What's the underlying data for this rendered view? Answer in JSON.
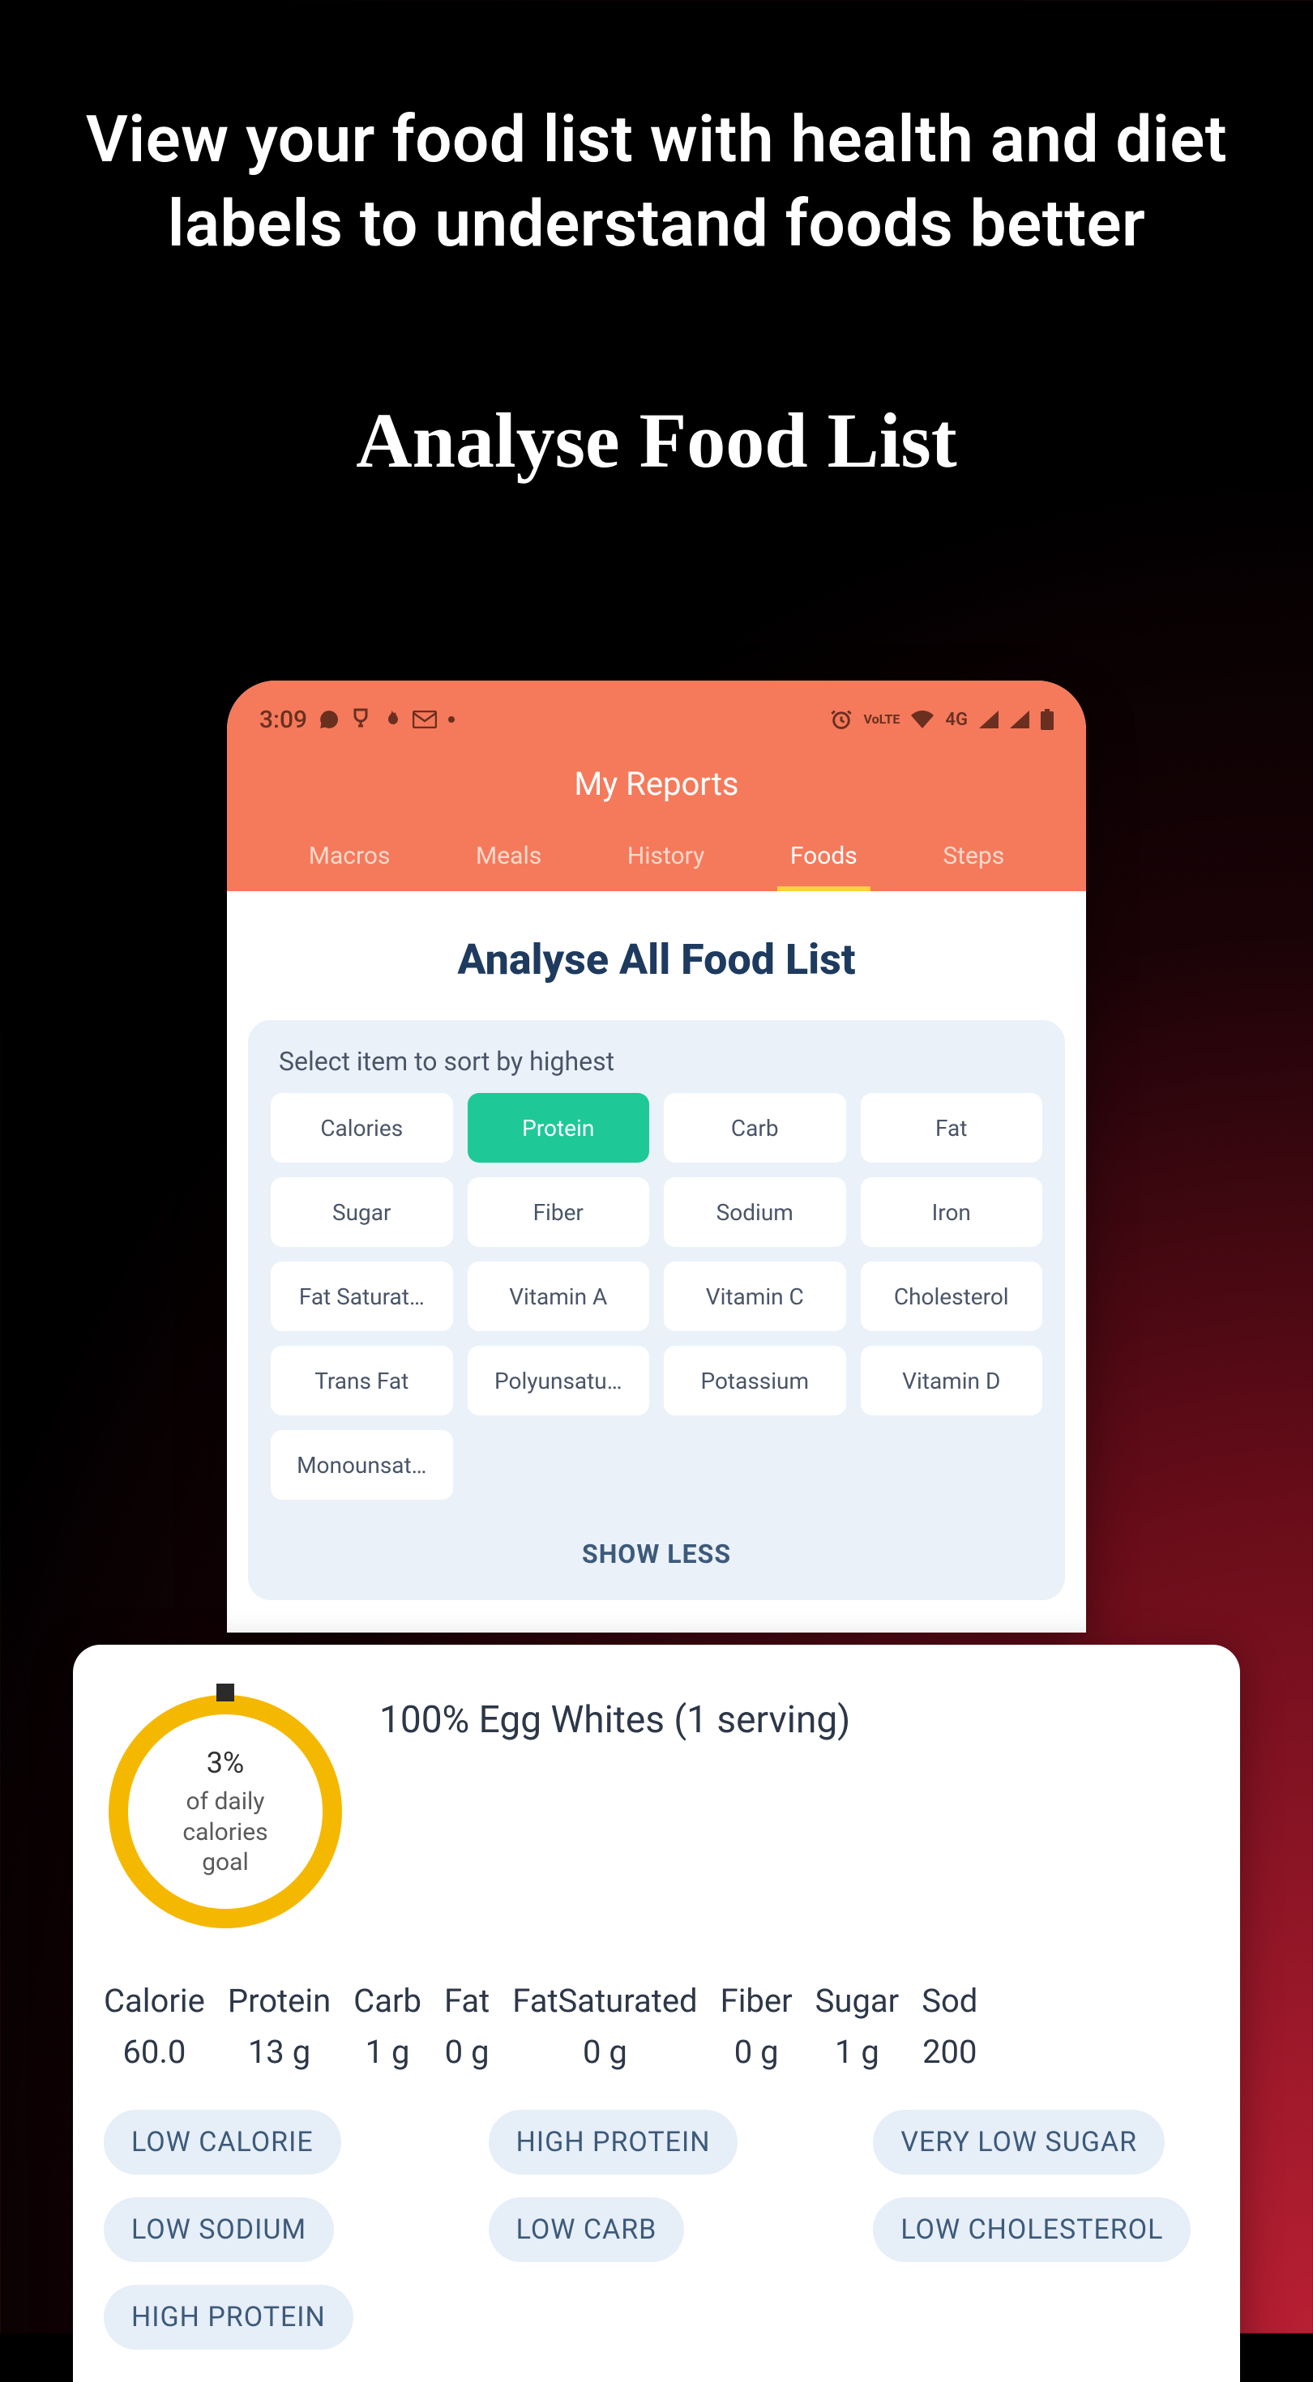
{
  "promo": {
    "heading": "View your food list with health and diet labels to understand foods better",
    "subheading": "Analyse Food List"
  },
  "statusbar": {
    "time": "3:09",
    "network_label": "4G",
    "lte_label": "LTE",
    "vo_label": "Vo"
  },
  "app": {
    "title": "My Reports",
    "tabs": [
      {
        "label": "Macros",
        "active": false
      },
      {
        "label": "Meals",
        "active": false
      },
      {
        "label": "History",
        "active": false
      },
      {
        "label": "Foods",
        "active": true
      },
      {
        "label": "Steps",
        "active": false
      }
    ],
    "content_title": "Analyse All Food List",
    "sort_label": "Select item to sort by highest",
    "sort_chips": [
      {
        "label": "Calories",
        "active": false
      },
      {
        "label": "Protein",
        "active": true
      },
      {
        "label": "Carb",
        "active": false
      },
      {
        "label": "Fat",
        "active": false
      },
      {
        "label": "Sugar",
        "active": false
      },
      {
        "label": "Fiber",
        "active": false
      },
      {
        "label": "Sodium",
        "active": false
      },
      {
        "label": "Iron",
        "active": false
      },
      {
        "label": "Fat Saturat…",
        "active": false
      },
      {
        "label": "Vitamin A",
        "active": false
      },
      {
        "label": "Vitamin C",
        "active": false
      },
      {
        "label": "Cholesterol",
        "active": false
      },
      {
        "label": "Trans Fat",
        "active": false
      },
      {
        "label": "Polyunsatu…",
        "active": false
      },
      {
        "label": "Potassium",
        "active": false
      },
      {
        "label": "Vitamin D",
        "active": false
      },
      {
        "label": "Monounsat…",
        "active": false
      }
    ],
    "show_less": "SHOW LESS"
  },
  "food": {
    "ring": {
      "percent_label": "3%",
      "sub1": "of daily",
      "sub2": "calories",
      "sub3": "goal",
      "percent_value": 3
    },
    "name": "100% Egg Whites (1 serving)",
    "nutrients": [
      {
        "label": "Calorie",
        "value": "60.0"
      },
      {
        "label": "Protein",
        "value": "13 g"
      },
      {
        "label": "Carb",
        "value": "1 g"
      },
      {
        "label": "Fat",
        "value": "0 g"
      },
      {
        "label": "FatSaturated",
        "value": "0 g"
      },
      {
        "label": "Fiber",
        "value": "0 g"
      },
      {
        "label": "Sugar",
        "value": "1 g"
      },
      {
        "label": "Sod",
        "value": "200"
      }
    ],
    "badges": [
      "LOW CALORIE",
      "HIGH PROTEIN",
      "VERY LOW SUGAR",
      "LOW SODIUM",
      "LOW CARB",
      "LOW CHOLESTEROL",
      "HIGH PROTEIN"
    ]
  }
}
